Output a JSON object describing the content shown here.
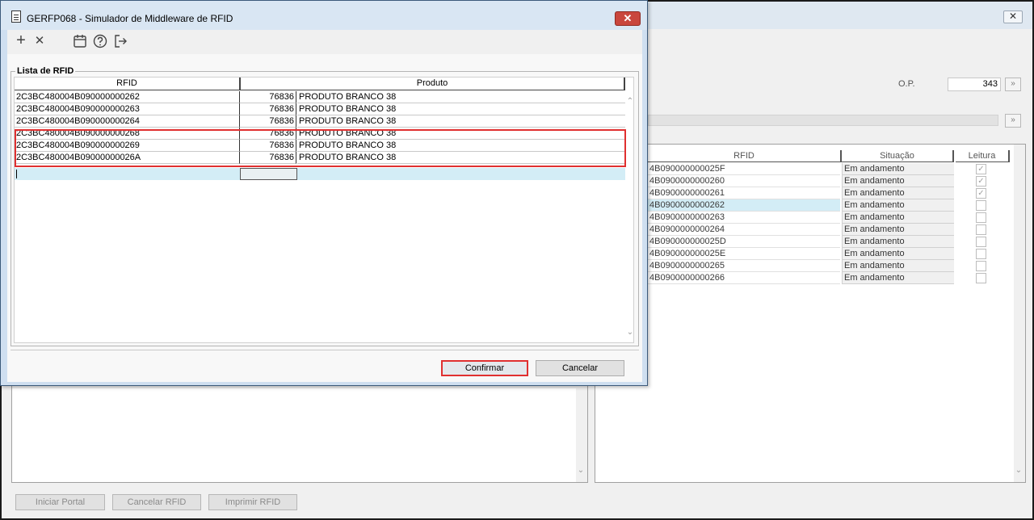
{
  "background_window": {
    "close_glyph": "✕",
    "op_label": "O.P.",
    "op_value": "343",
    "lookup_glyph": "»",
    "right_table": {
      "headers": {
        "rfid": "RFID",
        "situacao": "Situação",
        "leitura": "Leitura"
      },
      "rows": [
        {
          "rfid": "4B090000000025F",
          "situacao": "Em andamento",
          "leitura": true
        },
        {
          "rfid": "4B0900000000260",
          "situacao": "Em andamento",
          "leitura": true
        },
        {
          "rfid": "4B0900000000261",
          "situacao": "Em andamento",
          "leitura": true
        },
        {
          "rfid": "4B0900000000262",
          "situacao": "Em andamento",
          "leitura": false
        },
        {
          "rfid": "4B0900000000263",
          "situacao": "Em andamento",
          "leitura": false
        },
        {
          "rfid": "4B0900000000264",
          "situacao": "Em andamento",
          "leitura": false
        },
        {
          "rfid": "4B090000000025D",
          "situacao": "Em andamento",
          "leitura": false
        },
        {
          "rfid": "4B090000000025E",
          "situacao": "Em andamento",
          "leitura": false
        },
        {
          "rfid": "4B0900000000265",
          "situacao": "Em andamento",
          "leitura": false
        },
        {
          "rfid": "4B0900000000266",
          "situacao": "Em andamento",
          "leitura": false
        }
      ]
    },
    "buttons": {
      "iniciar_portal": "Iniciar Portal",
      "cancelar_rfid": "Cancelar RFID",
      "imprimir_rfid": "Imprimir RFID"
    }
  },
  "dialog": {
    "title": "GERFP068 - Simulador de Middleware de RFID",
    "close_glyph": "✕",
    "toolbar": {
      "add_glyph": "+",
      "remove_glyph": "✕"
    },
    "group_label": "Lista de RFID",
    "grid": {
      "headers": {
        "rfid": "RFID",
        "produto": "Produto"
      },
      "rows": [
        {
          "rfid": "2C3BC480004B090000000262",
          "code": "76836",
          "produto": "PRODUTO BRANCO 38"
        },
        {
          "rfid": "2C3BC480004B090000000263",
          "code": "76836",
          "produto": "PRODUTO BRANCO 38"
        },
        {
          "rfid": "2C3BC480004B090000000264",
          "code": "76836",
          "produto": "PRODUTO BRANCO 38"
        },
        {
          "rfid": "2C3BC480004B090000000268",
          "code": "76836",
          "produto": "PRODUTO BRANCO 38"
        },
        {
          "rfid": "2C3BC480004B090000000269",
          "code": "76836",
          "produto": "PRODUTO BRANCO 38"
        },
        {
          "rfid": "2C3BC480004B09000000026A",
          "code": "76836",
          "produto": "PRODUTO BRANCO 38"
        }
      ]
    },
    "buttons": {
      "confirmar": "Confirmar",
      "cancelar": "Cancelar"
    }
  },
  "colors": {
    "highlight": "#e03030",
    "dialog_frame": "#cfdff0",
    "selected_row": "#d3edf6"
  }
}
